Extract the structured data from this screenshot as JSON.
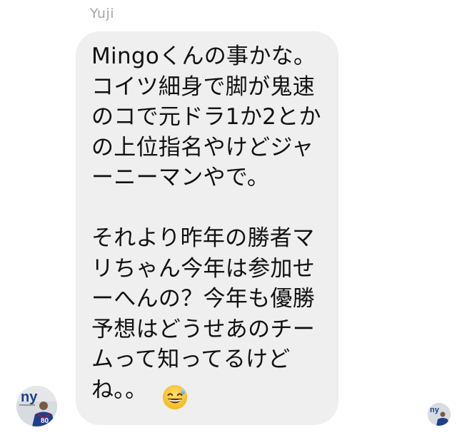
{
  "conversation": {
    "sender_name": "Yuji",
    "message": {
      "lines": [
        "Mingoくんの事かな。",
        "コイツ細身で脚が鬼速",
        "のコで元ドラ1か2とか",
        "の上位指名やけどジャ",
        "ーニーマンやで。",
        "",
        "それより昨年の勝者マ",
        "リちゃん今年は参加せ",
        "ーへんの？今年も優勝",
        "予想はどうせあのチー",
        "ムって知ってるけど",
        "ね。。"
      ],
      "emoji": "grinning-face-with-sweat-icon"
    },
    "avatar_left": {
      "logo_text": "ny",
      "jersey_number": "80",
      "icon": "profile-photo-icon"
    },
    "avatar_right": {
      "logo_text": "ny",
      "icon": "read-receipt-avatar-icon"
    }
  },
  "colors": {
    "bubble_bg": "#efeff0",
    "text": "#111111",
    "sender_name": "#a4a6aa",
    "logo_blue": "#1e3f8a",
    "logo_red": "#c8102e"
  }
}
